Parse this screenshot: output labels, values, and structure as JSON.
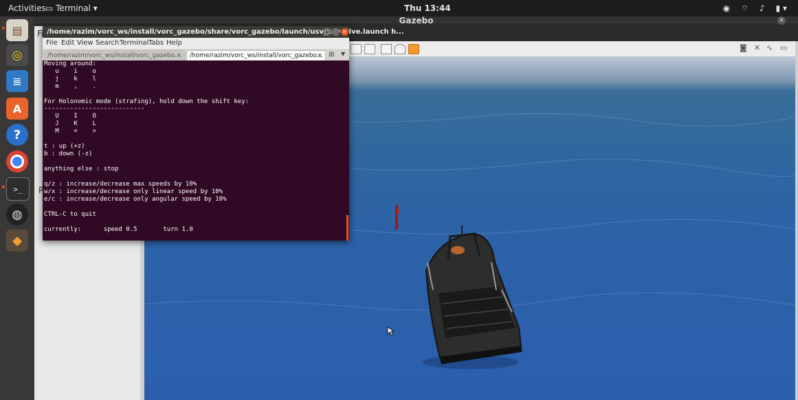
{
  "topbar": {
    "activities": "Activities",
    "app_name": "Terminal",
    "clock": "Thu 13:44"
  },
  "gazebo": {
    "title": "Gazebo",
    "left_menu": "Fil",
    "left_label": "P"
  },
  "terminal": {
    "title": "/home/razim/vorc_ws/install/vorc_gazebo/share/vorc_gazebo/launch/usv_keydrive.launch h...",
    "menu": [
      "File",
      "Edit",
      "View",
      "Search",
      "Terminal",
      "Tabs",
      "Help"
    ],
    "tabs": [
      {
        "label": "/home/razim/vorc_ws/install/vorc_gazebo...",
        "active": false
      },
      {
        "label": "/home/razim/vorc_ws/install/vorc_gazebo...",
        "active": true
      }
    ],
    "lines": [
      "Moving around:",
      "   u    i    o",
      "   j    k    l",
      "   m    ,    .",
      "",
      "For Holonomic mode (strafing), hold down the shift key:",
      "---------------------------",
      "   U    I    O",
      "   J    K    L",
      "   M    <    >",
      "",
      "t : up (+z)",
      "b : down (-z)",
      "",
      "anything else : stop",
      "",
      "q/z : increase/decrease max speeds by 10%",
      "w/x : increase/decrease only linear speed by 10%",
      "e/c : increase/decrease only angular speed by 10%",
      "",
      "CTRL-C to quit",
      "",
      "currently:      speed 0.5       turn 1.0"
    ]
  },
  "colors": {
    "terminal_bg": "#300a24",
    "accent": "#e95420",
    "water": "#2c62a8"
  }
}
